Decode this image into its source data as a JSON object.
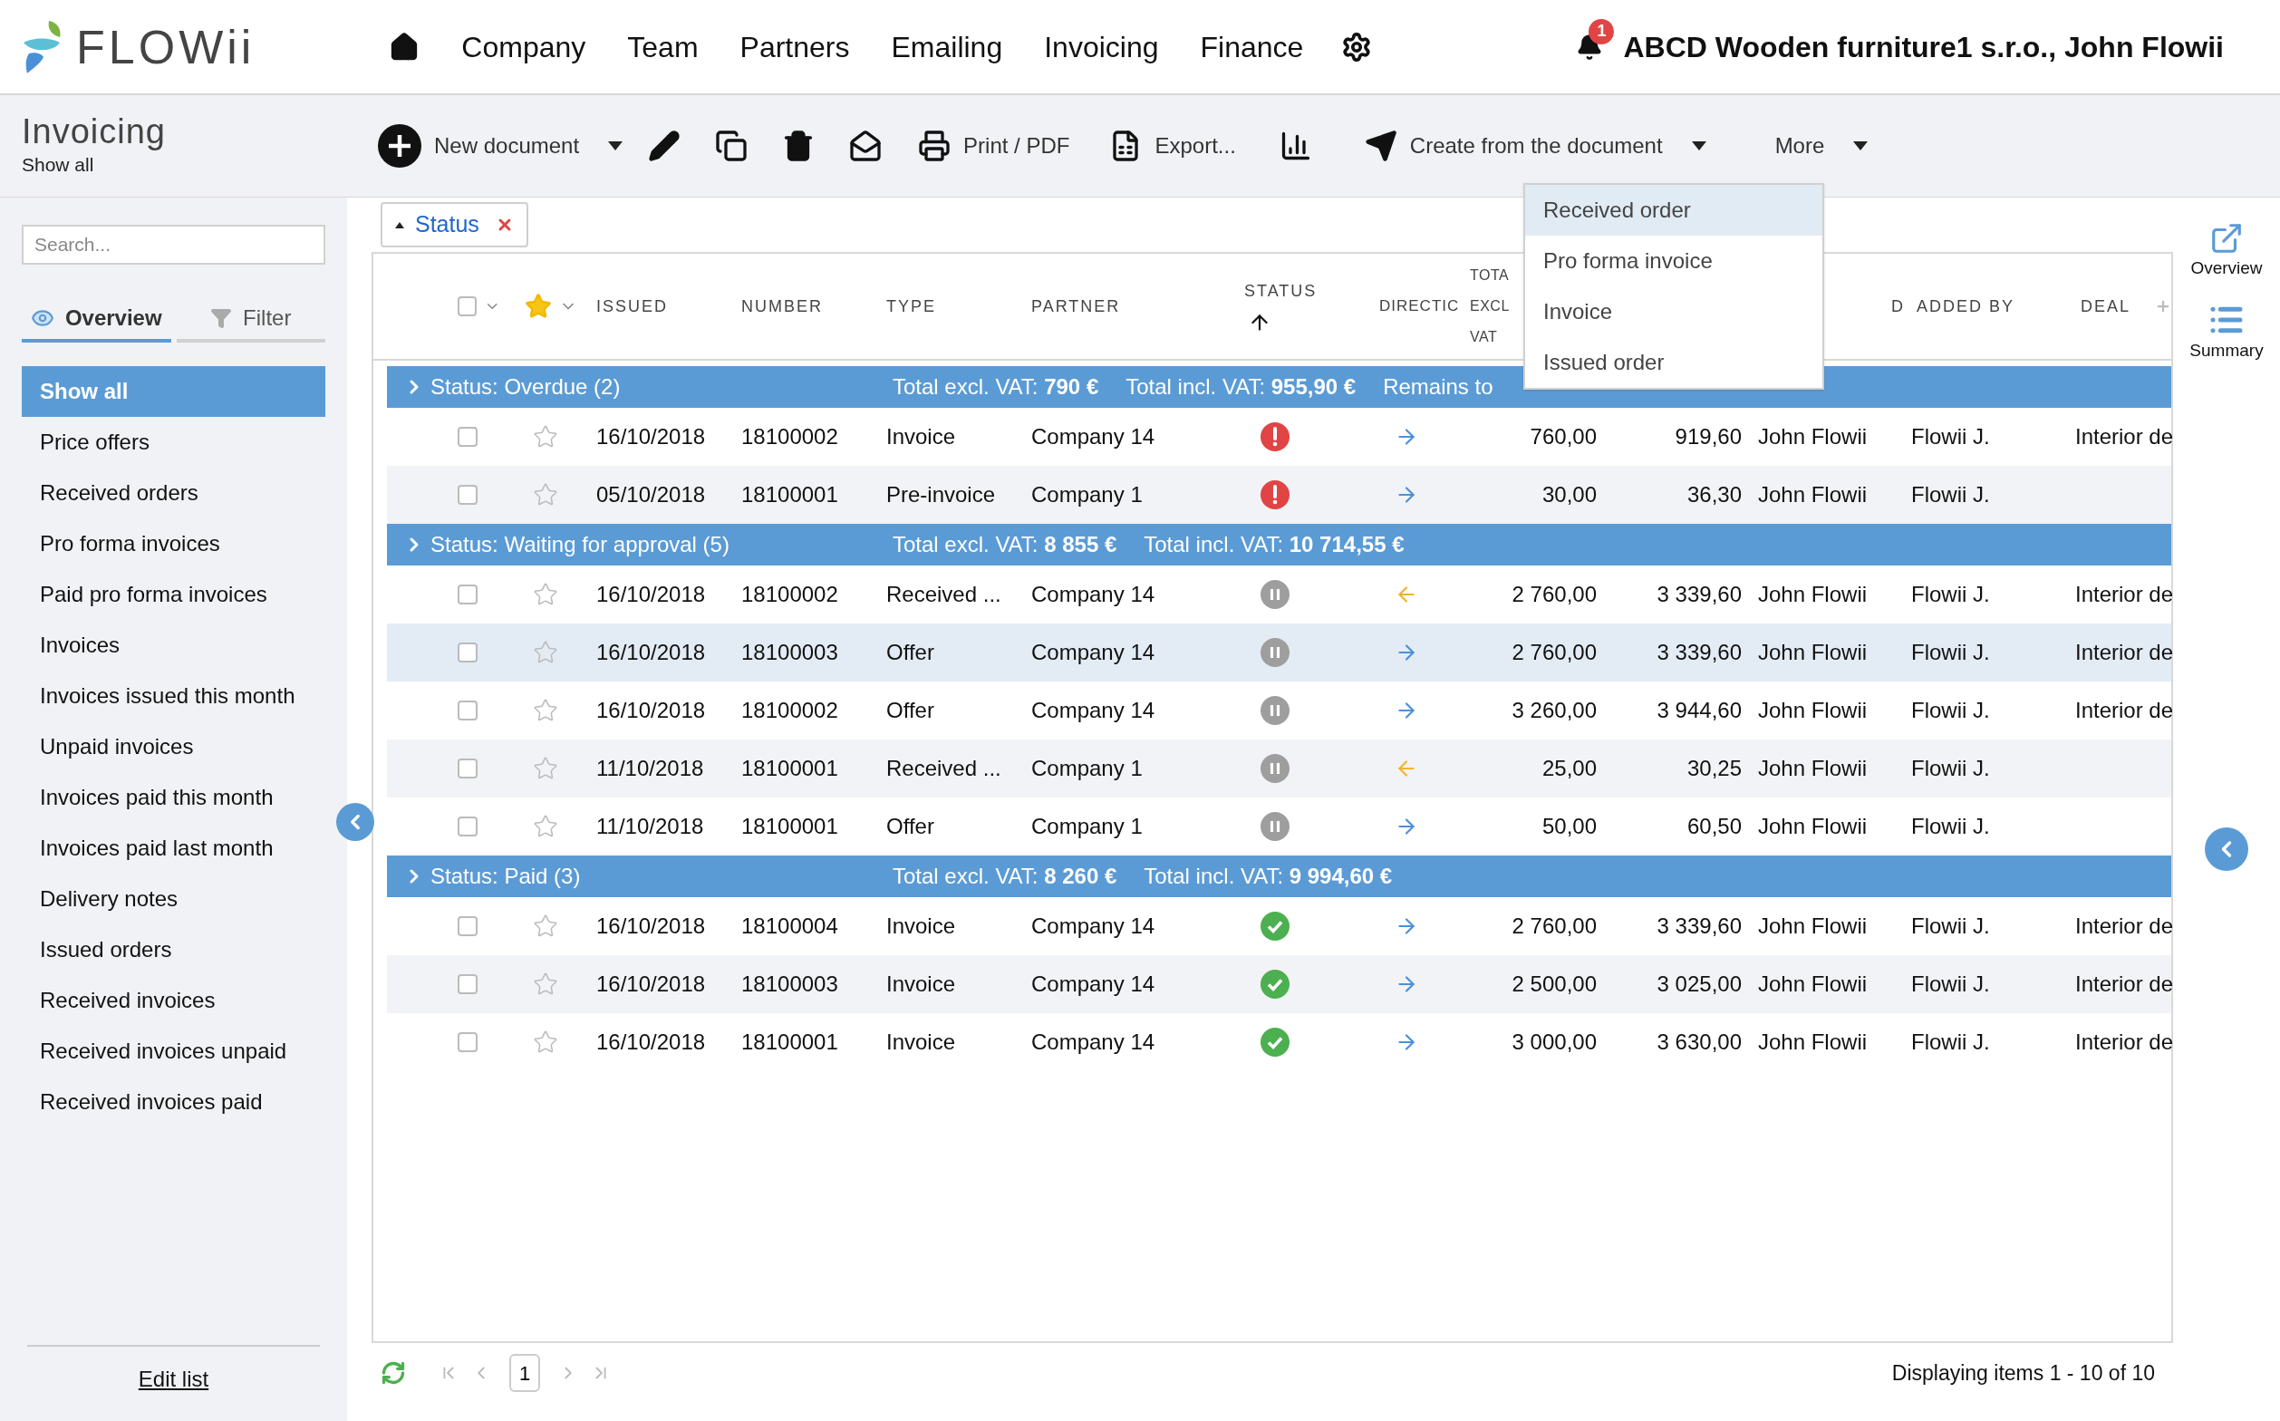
{
  "logo": "FLOWii",
  "nav": [
    "Company",
    "Team",
    "Partners",
    "Emailing",
    "Invoicing",
    "Finance"
  ],
  "notifications": "1",
  "account": "ABCD Wooden furniture1 s.r.o., John Flowii",
  "page": {
    "title": "Invoicing",
    "subtitle": "Show all"
  },
  "toolbar": [
    {
      "kind": "new",
      "label": "New document"
    },
    {
      "kind": "edit"
    },
    {
      "kind": "copy"
    },
    {
      "kind": "delete"
    },
    {
      "kind": "mail"
    },
    {
      "kind": "print",
      "label": "Print / PDF"
    },
    {
      "kind": "export",
      "label": "Export..."
    },
    {
      "kind": "chart"
    },
    {
      "kind": "create",
      "label": "Create from the document"
    },
    {
      "kind": "more",
      "label": "More"
    }
  ],
  "create_menu": [
    {
      "label": "Received order",
      "selected": true
    },
    {
      "label": "Pro forma invoice",
      "selected": false
    },
    {
      "label": "Invoice",
      "selected": false
    },
    {
      "label": "Issued order",
      "selected": false
    }
  ],
  "sidebar": {
    "search": {
      "placeholder": "Search..."
    },
    "tabs": [
      {
        "label": "Overview",
        "selected": true
      },
      {
        "label": "Filter",
        "selected": false
      }
    ],
    "items": [
      {
        "label": "Show all",
        "selected": true
      },
      {
        "label": "Price offers",
        "selected": false
      },
      {
        "label": "Received orders",
        "selected": false
      },
      {
        "label": "Pro forma invoices",
        "selected": false
      },
      {
        "label": "Paid pro forma invoices",
        "selected": false
      },
      {
        "label": "Invoices",
        "selected": false
      },
      {
        "label": "Invoices issued this month",
        "selected": false
      },
      {
        "label": "Unpaid invoices",
        "selected": false
      },
      {
        "label": "Invoices paid this month",
        "selected": false
      },
      {
        "label": "Invoices paid last month",
        "selected": false
      },
      {
        "label": "Delivery notes",
        "selected": false
      },
      {
        "label": "Issued orders",
        "selected": false
      },
      {
        "label": "Received invoices",
        "selected": false
      },
      {
        "label": "Received invoices unpaid",
        "selected": false
      },
      {
        "label": "Received invoices paid",
        "selected": false
      }
    ],
    "edit_link": "Edit list"
  },
  "grouping_chip": {
    "label": "Status"
  },
  "table": {
    "select_all": {
      "checked": false
    },
    "columns": [
      "ISSUED",
      "NUMBER",
      "TYPE",
      "PARTNER",
      "STATUS",
      "DIRECTIC",
      "TOTA EXCL VAT",
      "D",
      "ADDED BY",
      "DEAL"
    ],
    "groups": [
      {
        "label": "Status: Overdue (2)",
        "summary": [
          "Total excl. VAT: **790 €**",
          "Total incl. VAT: **955,90 €**",
          "Remains to"
        ],
        "rows": [
          {
            "selected": false,
            "checked": false,
            "starred": false,
            "issued": "16/10/2018",
            "number": "18100002",
            "type": "Invoice",
            "partner": "Company 14",
            "kind": "overdue",
            "incoming": false,
            "total_excl": "760,00",
            "total_incl": "919,60",
            "column_10": "John Flowii",
            "added_by": "Flowii J.",
            "deal": "Interior de"
          },
          {
            "selected": false,
            "checked": false,
            "starred": false,
            "issued": "05/10/2018",
            "number": "18100001",
            "type": "Pre-invoice",
            "partner": "Company 1",
            "kind": "overdue",
            "incoming": false,
            "total_excl": "30,00",
            "total_incl": "36,30",
            "column_10": "John Flowii",
            "added_by": "Flowii J."
          }
        ]
      },
      {
        "label": "Status: Waiting for approval (5)",
        "summary": [
          "Total excl. VAT: **8 855 €**",
          "Total incl. VAT: **10 714,55 €**"
        ],
        "rows": [
          {
            "selected": false,
            "checked": false,
            "starred": false,
            "issued": "16/10/2018",
            "number": "18100002",
            "type": "Received ...",
            "partner": "Company 14",
            "kind": "waiting",
            "incoming": true,
            "total_excl": "2 760,00",
            "total_incl": "3 339,60",
            "column_10": "John Flowii",
            "added_by": "Flowii J.",
            "deal": "Interior de"
          },
          {
            "selected": true,
            "checked": false,
            "starred": false,
            "issued": "16/10/2018",
            "number": "18100003",
            "type": "Offer",
            "partner": "Company 14",
            "kind": "waiting",
            "incoming": false,
            "total_excl": "2 760,00",
            "total_incl": "3 339,60",
            "column_10": "John Flowii",
            "added_by": "Flowii J.",
            "deal": "Interior de"
          },
          {
            "selected": false,
            "checked": false,
            "starred": false,
            "issued": "16/10/2018",
            "number": "18100002",
            "type": "Offer",
            "partner": "Company 14",
            "kind": "waiting",
            "incoming": false,
            "total_excl": "3 260,00",
            "total_incl": "3 944,60",
            "column_10": "John Flowii",
            "added_by": "Flowii J.",
            "deal": "Interior de"
          },
          {
            "selected": false,
            "checked": false,
            "starred": false,
            "issued": "11/10/2018",
            "number": "18100001",
            "type": "Received ...",
            "partner": "Company 1",
            "kind": "waiting",
            "incoming": true,
            "total_excl": "25,00",
            "total_incl": "30,25",
            "column_10": "John Flowii",
            "added_by": "Flowii J."
          },
          {
            "selected": false,
            "checked": false,
            "starred": false,
            "issued": "11/10/2018",
            "number": "18100001",
            "type": "Offer",
            "partner": "Company 1",
            "kind": "waiting",
            "incoming": false,
            "total_excl": "50,00",
            "total_incl": "60,50",
            "column_10": "John Flowii",
            "added_by": "Flowii J."
          }
        ]
      },
      {
        "label": "Status: Paid (3)",
        "summary": [
          "Total excl. VAT: **8 260 €**",
          "Total incl. VAT: **9 994,60 €**"
        ],
        "rows": [
          {
            "selected": false,
            "checked": false,
            "starred": false,
            "issued": "16/10/2018",
            "number": "18100004",
            "type": "Invoice",
            "partner": "Company 14",
            "kind": "paid",
            "incoming": false,
            "total_excl": "2 760,00",
            "total_incl": "3 339,60",
            "column_10": "John Flowii",
            "added_by": "Flowii J.",
            "deal": "Interior de"
          },
          {
            "selected": false,
            "checked": false,
            "starred": false,
            "issued": "16/10/2018",
            "number": "18100003",
            "type": "Invoice",
            "partner": "Company 14",
            "kind": "paid",
            "incoming": false,
            "total_excl": "2 500,00",
            "total_incl": "3 025,00",
            "column_10": "John Flowii",
            "added_by": "Flowii J.",
            "deal": "Interior de"
          },
          {
            "selected": false,
            "checked": false,
            "starred": false,
            "issued": "16/10/2018",
            "number": "18100001",
            "type": "Invoice",
            "partner": "Company 14",
            "kind": "paid",
            "incoming": false,
            "total_excl": "3 000,00",
            "total_incl": "3 630,00",
            "column_10": "John Flowii",
            "added_by": "Flowii J.",
            "deal": "Interior de"
          }
        ]
      }
    ]
  },
  "pager": {
    "page": "1",
    "info": "Displaying items 1 - 10 of 10"
  },
  "right_rail": [
    {
      "kind": "overview",
      "label": "Overview"
    },
    {
      "kind": "summary",
      "label": "Summary"
    }
  ]
}
